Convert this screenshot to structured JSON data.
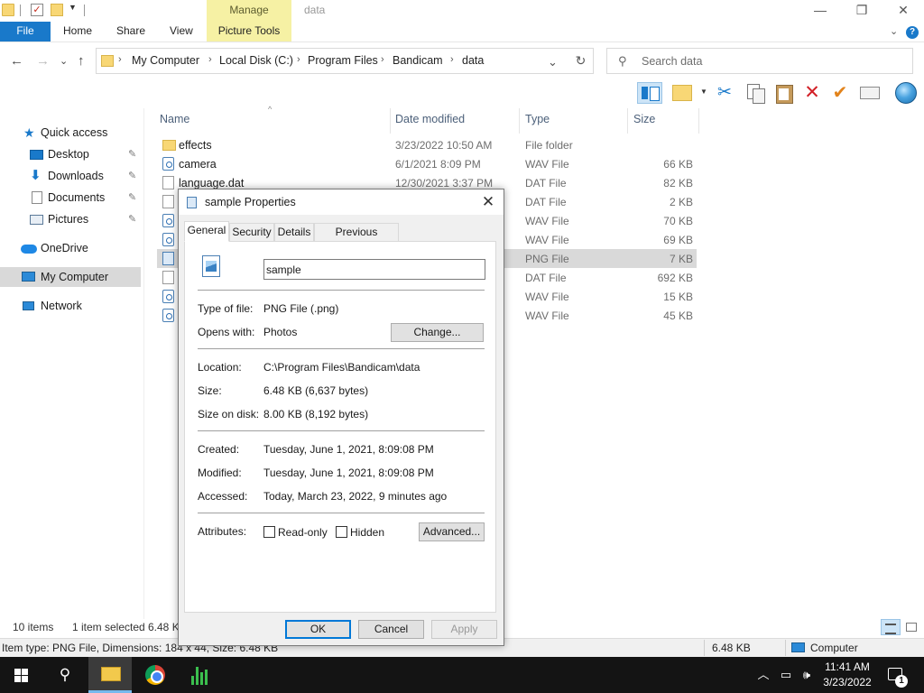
{
  "window": {
    "title": "data",
    "context_tab": "Manage",
    "minimize": "—",
    "maximize": "❐",
    "close": "✕"
  },
  "ribbon": {
    "file": "File",
    "tabs": [
      "Home",
      "Share",
      "View",
      "Picture Tools"
    ],
    "expand": "⌄"
  },
  "address": {
    "back": "←",
    "forward": "→",
    "recent": "⌄",
    "up": "↑",
    "breadcrumb": [
      "My Computer",
      "Local Disk (C:)",
      "Program Files",
      "Bandicam",
      "data"
    ],
    "separator": "›",
    "dropdown": "⌄",
    "refresh": "↻",
    "search_placeholder": "Search data"
  },
  "navpane": {
    "items": [
      {
        "label": "Quick access",
        "icon": "star-icon",
        "pinned": false
      },
      {
        "label": "Desktop",
        "icon": "desktop-icon",
        "pinned": true
      },
      {
        "label": "Downloads",
        "icon": "download-icon",
        "pinned": true
      },
      {
        "label": "Documents",
        "icon": "document-icon",
        "pinned": true
      },
      {
        "label": "Pictures",
        "icon": "pictures-icon",
        "pinned": true
      },
      {
        "label": "OneDrive",
        "icon": "cloud-icon",
        "pinned": false
      },
      {
        "label": "My Computer",
        "icon": "computer-icon",
        "pinned": false
      },
      {
        "label": "Network",
        "icon": "network-icon",
        "pinned": false
      }
    ],
    "pin_glyph": "📌"
  },
  "filelist": {
    "columns": [
      "Name",
      "Date modified",
      "Type",
      "Size"
    ],
    "sort_glyph": "^",
    "rows": [
      {
        "name": "effects",
        "date": "3/23/2022 10:50 AM",
        "type": "File folder",
        "size": "",
        "icon": "folder"
      },
      {
        "name": "camera",
        "date": "6/1/2021 8:09 PM",
        "type": "WAV File",
        "size": "66 KB",
        "icon": "wav"
      },
      {
        "name": "language.dat",
        "date": "12/30/2021 3:37 PM",
        "type": "DAT File",
        "size": "82 KB",
        "icon": "dat"
      },
      {
        "name": "",
        "date": "",
        "type": "DAT File",
        "size": "2 KB",
        "icon": "dat"
      },
      {
        "name": "",
        "date": "",
        "type": "WAV File",
        "size": "70 KB",
        "icon": "wav"
      },
      {
        "name": "",
        "date": "",
        "type": "WAV File",
        "size": "69 KB",
        "icon": "wav"
      },
      {
        "name": "",
        "date": "",
        "type": "PNG File",
        "size": "7 KB",
        "icon": "png",
        "selected": true
      },
      {
        "name": "",
        "date": "",
        "type": "DAT File",
        "size": "692 KB",
        "icon": "dat"
      },
      {
        "name": "",
        "date": "",
        "type": "WAV File",
        "size": "15 KB",
        "icon": "wav"
      },
      {
        "name": "",
        "date": "",
        "type": "WAV File",
        "size": "45 KB",
        "icon": "wav"
      }
    ]
  },
  "status": {
    "item_count": "10 items",
    "selection": "1 item selected",
    "selection_size": "6.48 K",
    "info": "Item type: PNG File, Dimensions: 184 x 44, Size: 6.48 KB",
    "info_size": "6.48 KB",
    "info_location": "Computer"
  },
  "taskbar": {
    "search_glyph": "⚲",
    "tray_chevron": "︿",
    "network_glyph": "▭",
    "volume_glyph": "🕪",
    "time": "11:41 AM",
    "date": "3/23/2022",
    "notification_count": "1"
  },
  "dialog": {
    "title": "sample Properties",
    "close": "✕",
    "tabs": [
      "General",
      "Security",
      "Details",
      "Previous Versions"
    ],
    "active_tab": "General",
    "filename": "sample",
    "type_label": "Type of file:",
    "type_value": "PNG File (.png)",
    "opens_label": "Opens with:",
    "opens_value": "Photos",
    "change_button": "Change...",
    "location_label": "Location:",
    "location_value": "C:\\Program Files\\Bandicam\\data",
    "size_label": "Size:",
    "size_value": "6.48 KB (6,637 bytes)",
    "disk_label": "Size on disk:",
    "disk_value": "8.00 KB (8,192 bytes)",
    "created_label": "Created:",
    "created_value": "Tuesday, June 1, 2021, 8:09:08 PM",
    "modified_label": "Modified:",
    "modified_value": "Tuesday, June 1, 2021, 8:09:08 PM",
    "accessed_label": "Accessed:",
    "accessed_value": "Today, March 23, 2022, 9 minutes ago",
    "attributes_label": "Attributes:",
    "readonly_label": "Read-only",
    "readonly_checked": false,
    "hidden_label": "Hidden",
    "hidden_checked": false,
    "advanced_button": "Advanced...",
    "ok_button": "OK",
    "cancel_button": "Cancel",
    "apply_button": "Apply"
  }
}
